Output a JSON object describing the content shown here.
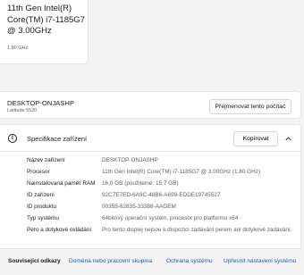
{
  "processor_card": {
    "name": "11th Gen Intel(R) Core(TM) i7-1185G7 @ 3.00GHz",
    "speed": "1.80 GHz"
  },
  "device": {
    "name": "DESKTOP-ONJASHP",
    "model": "Latitude 5520",
    "rename_label": "Přejmenovat tento počítač"
  },
  "specs": {
    "title": "Specifikace zařízení",
    "copy_label": "Kopírovat",
    "rows": [
      {
        "label": "Název zařízení",
        "value": "DESKTOP-ONJASHP"
      },
      {
        "label": "Procesor",
        "value": "11th Gen Intel(R) Core(TM) i7-1185G7 @ 3.00GHz (1.80 GHz)"
      },
      {
        "label": "Nainstalovaná paměť RAM",
        "value": "16,0 GB (použitelné: 15,7 GB)"
      },
      {
        "label": "ID zařízení",
        "value": "92C7E7ED-6A9C-48B6-A699-EDDE19745527"
      },
      {
        "label": "ID produktu",
        "value": "00355-62835-33388-AAOEM"
      },
      {
        "label": "Typ systému",
        "value": "64bitový operační systém, procesor pro platformu x64"
      },
      {
        "label": "Pero a dotykové ovládání",
        "value": "Pro tento displej nejsou k dispozici zadávání perem ani dotykové zadávání."
      }
    ]
  },
  "related": {
    "title": "Související odkazy",
    "links": [
      "Doména nebo pracovní skupina",
      "Ochrana systému",
      "Upřesnit nastavení systému"
    ]
  },
  "colors": {
    "link": "#1a5fb4",
    "background": "#f3f3f3",
    "card": "#ffffff"
  }
}
